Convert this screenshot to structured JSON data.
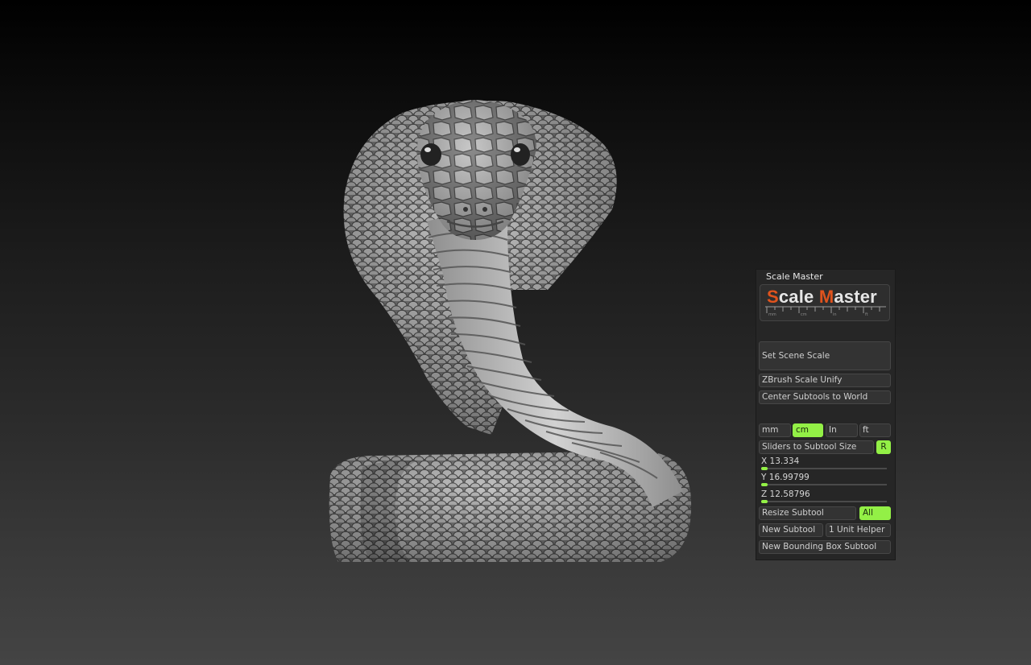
{
  "panel": {
    "title": "Scale Master",
    "logo": {
      "first_letter": "S",
      "rest1": "cale ",
      "second_letter": "M",
      "rest2": "aster",
      "ruler_labels": [
        "mm",
        "cm",
        "in",
        "ft"
      ]
    },
    "set_scene_scale": "Set Scene Scale",
    "zbrush_scale_unify": "ZBrush Scale Unify",
    "center_subtools": "Center Subtools to World",
    "units": [
      {
        "label": "mm",
        "selected": false
      },
      {
        "label": "cm",
        "selected": true
      },
      {
        "label": "In",
        "selected": false
      },
      {
        "label": "ft",
        "selected": false
      }
    ],
    "sliders_to_subtool_size": "Sliders to Subtool Size",
    "reset_label": "R",
    "sliders": [
      {
        "axis": "X",
        "value": "13.334",
        "level": 0.05
      },
      {
        "axis": "Y",
        "value": "16.99799",
        "level": 0.05
      },
      {
        "axis": "Z",
        "value": "12.58796",
        "level": 0.05
      }
    ],
    "resize_subtool": "Resize Subtool",
    "all_label": "All",
    "new_subtool": "New Subtool",
    "unit_helper": "1 Unit Helper",
    "new_bbox_subtool": "New Bounding Box Subtool"
  },
  "colors": {
    "accent": "#93f046",
    "logo_accent": "#e0531d",
    "panel_bg": "#262626"
  }
}
